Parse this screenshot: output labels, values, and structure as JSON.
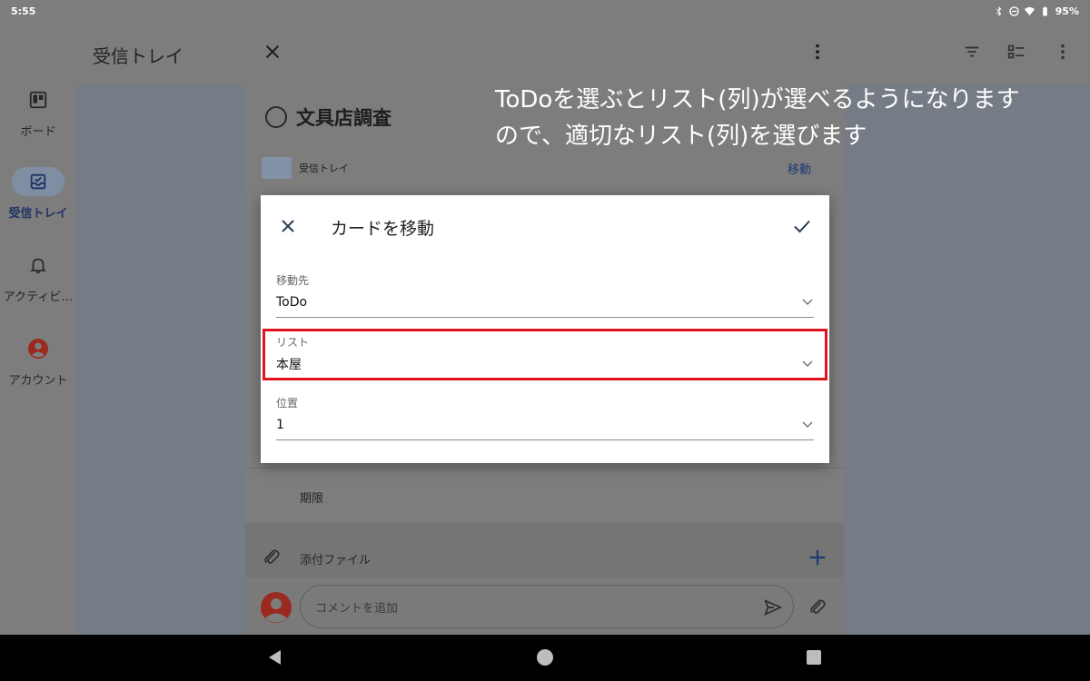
{
  "status_bar": {
    "time": "5:55",
    "battery": "95%"
  },
  "nav": {
    "items": [
      {
        "label": "ボード",
        "icon": "board-icon"
      },
      {
        "label": "受信トレイ",
        "icon": "inbox-icon",
        "active": true
      },
      {
        "label": "アクティビ…",
        "icon": "bell-icon"
      },
      {
        "label": "アカウント",
        "icon": "account-icon"
      }
    ]
  },
  "inbox": {
    "title": "受信トレイ"
  },
  "card": {
    "title": "文具店調査",
    "list_name": "受信トレイ",
    "move_label": "移動",
    "due_label": "期限",
    "attachments_label": "添付ファイル",
    "comment_placeholder": "コメントを追加"
  },
  "annotation": {
    "line1": "ToDoを選ぶとリスト(列)が選べるようになります",
    "line2": "ので、適切なリスト(列)を選びます"
  },
  "dialog": {
    "title": "カードを移動",
    "fields": [
      {
        "label": "移動先",
        "value": "ToDo"
      },
      {
        "label": "リスト",
        "value": "本屋"
      },
      {
        "label": "位置",
        "value": "1"
      }
    ]
  },
  "colors": {
    "highlight": "#e0141e",
    "accent": "#1d3a73"
  }
}
